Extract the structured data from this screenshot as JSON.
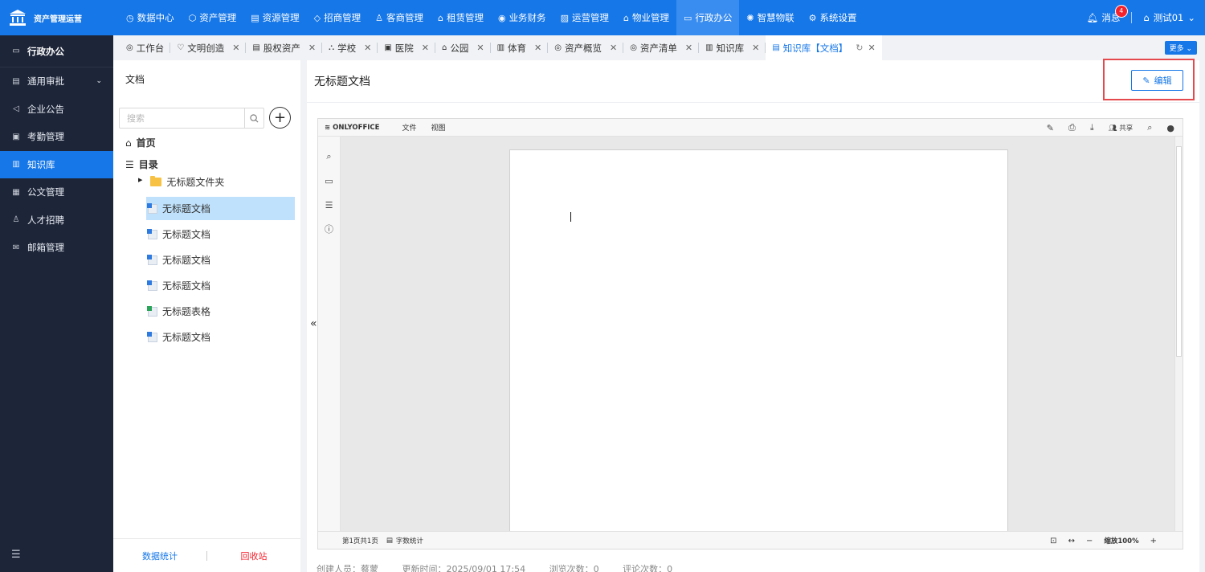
{
  "brand": {
    "title": "资产管理运营"
  },
  "topnav": [
    {
      "icon": "◷",
      "label": "数据中心"
    },
    {
      "icon": "⬡",
      "label": "资产管理"
    },
    {
      "icon": "▤",
      "label": "资源管理"
    },
    {
      "icon": "◇",
      "label": "招商管理"
    },
    {
      "icon": "♙",
      "label": "客商管理"
    },
    {
      "icon": "⌂",
      "label": "租赁管理"
    },
    {
      "icon": "◉",
      "label": "业务财务"
    },
    {
      "icon": "▨",
      "label": "运营管理"
    },
    {
      "icon": "⌂",
      "label": "物业管理"
    },
    {
      "icon": "▭",
      "label": "行政办公"
    },
    {
      "icon": "✺",
      "label": "智慧物联"
    },
    {
      "icon": "⚙",
      "label": "系统设置"
    }
  ],
  "topright": {
    "messages_label": "消息",
    "messages_count": "4",
    "user_name": "测试01"
  },
  "sidebar": {
    "section_title": "行政办公",
    "items": [
      {
        "icon": "▤",
        "label": "通用审批"
      },
      {
        "icon": "◁",
        "label": "企业公告"
      },
      {
        "icon": "▣",
        "label": "考勤管理"
      },
      {
        "icon": "▥",
        "label": "知识库"
      },
      {
        "icon": "▦",
        "label": "公文管理"
      },
      {
        "icon": "♙",
        "label": "人才招聘"
      },
      {
        "icon": "✉",
        "label": "邮箱管理"
      }
    ]
  },
  "tabs": [
    {
      "icon": "◎",
      "label": "工作台"
    },
    {
      "icon": "♡",
      "label": "文明创造"
    },
    {
      "icon": "▤",
      "label": "股权资产"
    },
    {
      "icon": "⛬",
      "label": "学校"
    },
    {
      "icon": "▣",
      "label": "医院"
    },
    {
      "icon": "⌂",
      "label": "公园"
    },
    {
      "icon": "▥",
      "label": "体育"
    },
    {
      "icon": "◎",
      "label": "资产概览"
    },
    {
      "icon": "◎",
      "label": "资产清单"
    },
    {
      "icon": "▥",
      "label": "知识库"
    },
    {
      "icon": "▤",
      "label": "知识库【文档】"
    }
  ],
  "tabbar": {
    "more_label": "更多 ⌄"
  },
  "docpanel": {
    "title": "文档",
    "search_placeholder": "搜索",
    "home_label": "首页",
    "dir_label": "目录",
    "folder_label": "无标题文件夹",
    "files": [
      {
        "label": "无标题文档",
        "kind": "doc"
      },
      {
        "label": "无标题文档",
        "kind": "doc"
      },
      {
        "label": "无标题文档",
        "kind": "doc"
      },
      {
        "label": "无标题文档",
        "kind": "doc"
      },
      {
        "label": "无标题表格",
        "kind": "sheet"
      },
      {
        "label": "无标题文档",
        "kind": "doc"
      }
    ],
    "stats_label": "数据统计",
    "recycle_label": "回收站"
  },
  "main": {
    "title": "无标题文档",
    "edit_label": "编辑",
    "meta": {
      "creator": "创建人员：蔡蒙",
      "updated": "更新时间：2025/09/01 17:54",
      "views": "浏览次数：0",
      "comments": "评论次数：0"
    }
  },
  "editor": {
    "logo": "ONLYOFFICE",
    "menu": [
      "文件",
      "视图"
    ],
    "share_label": "共享",
    "page_info": "第1页共1页",
    "word_count_label": "字数统计",
    "zoom_label": "缩放100%"
  }
}
